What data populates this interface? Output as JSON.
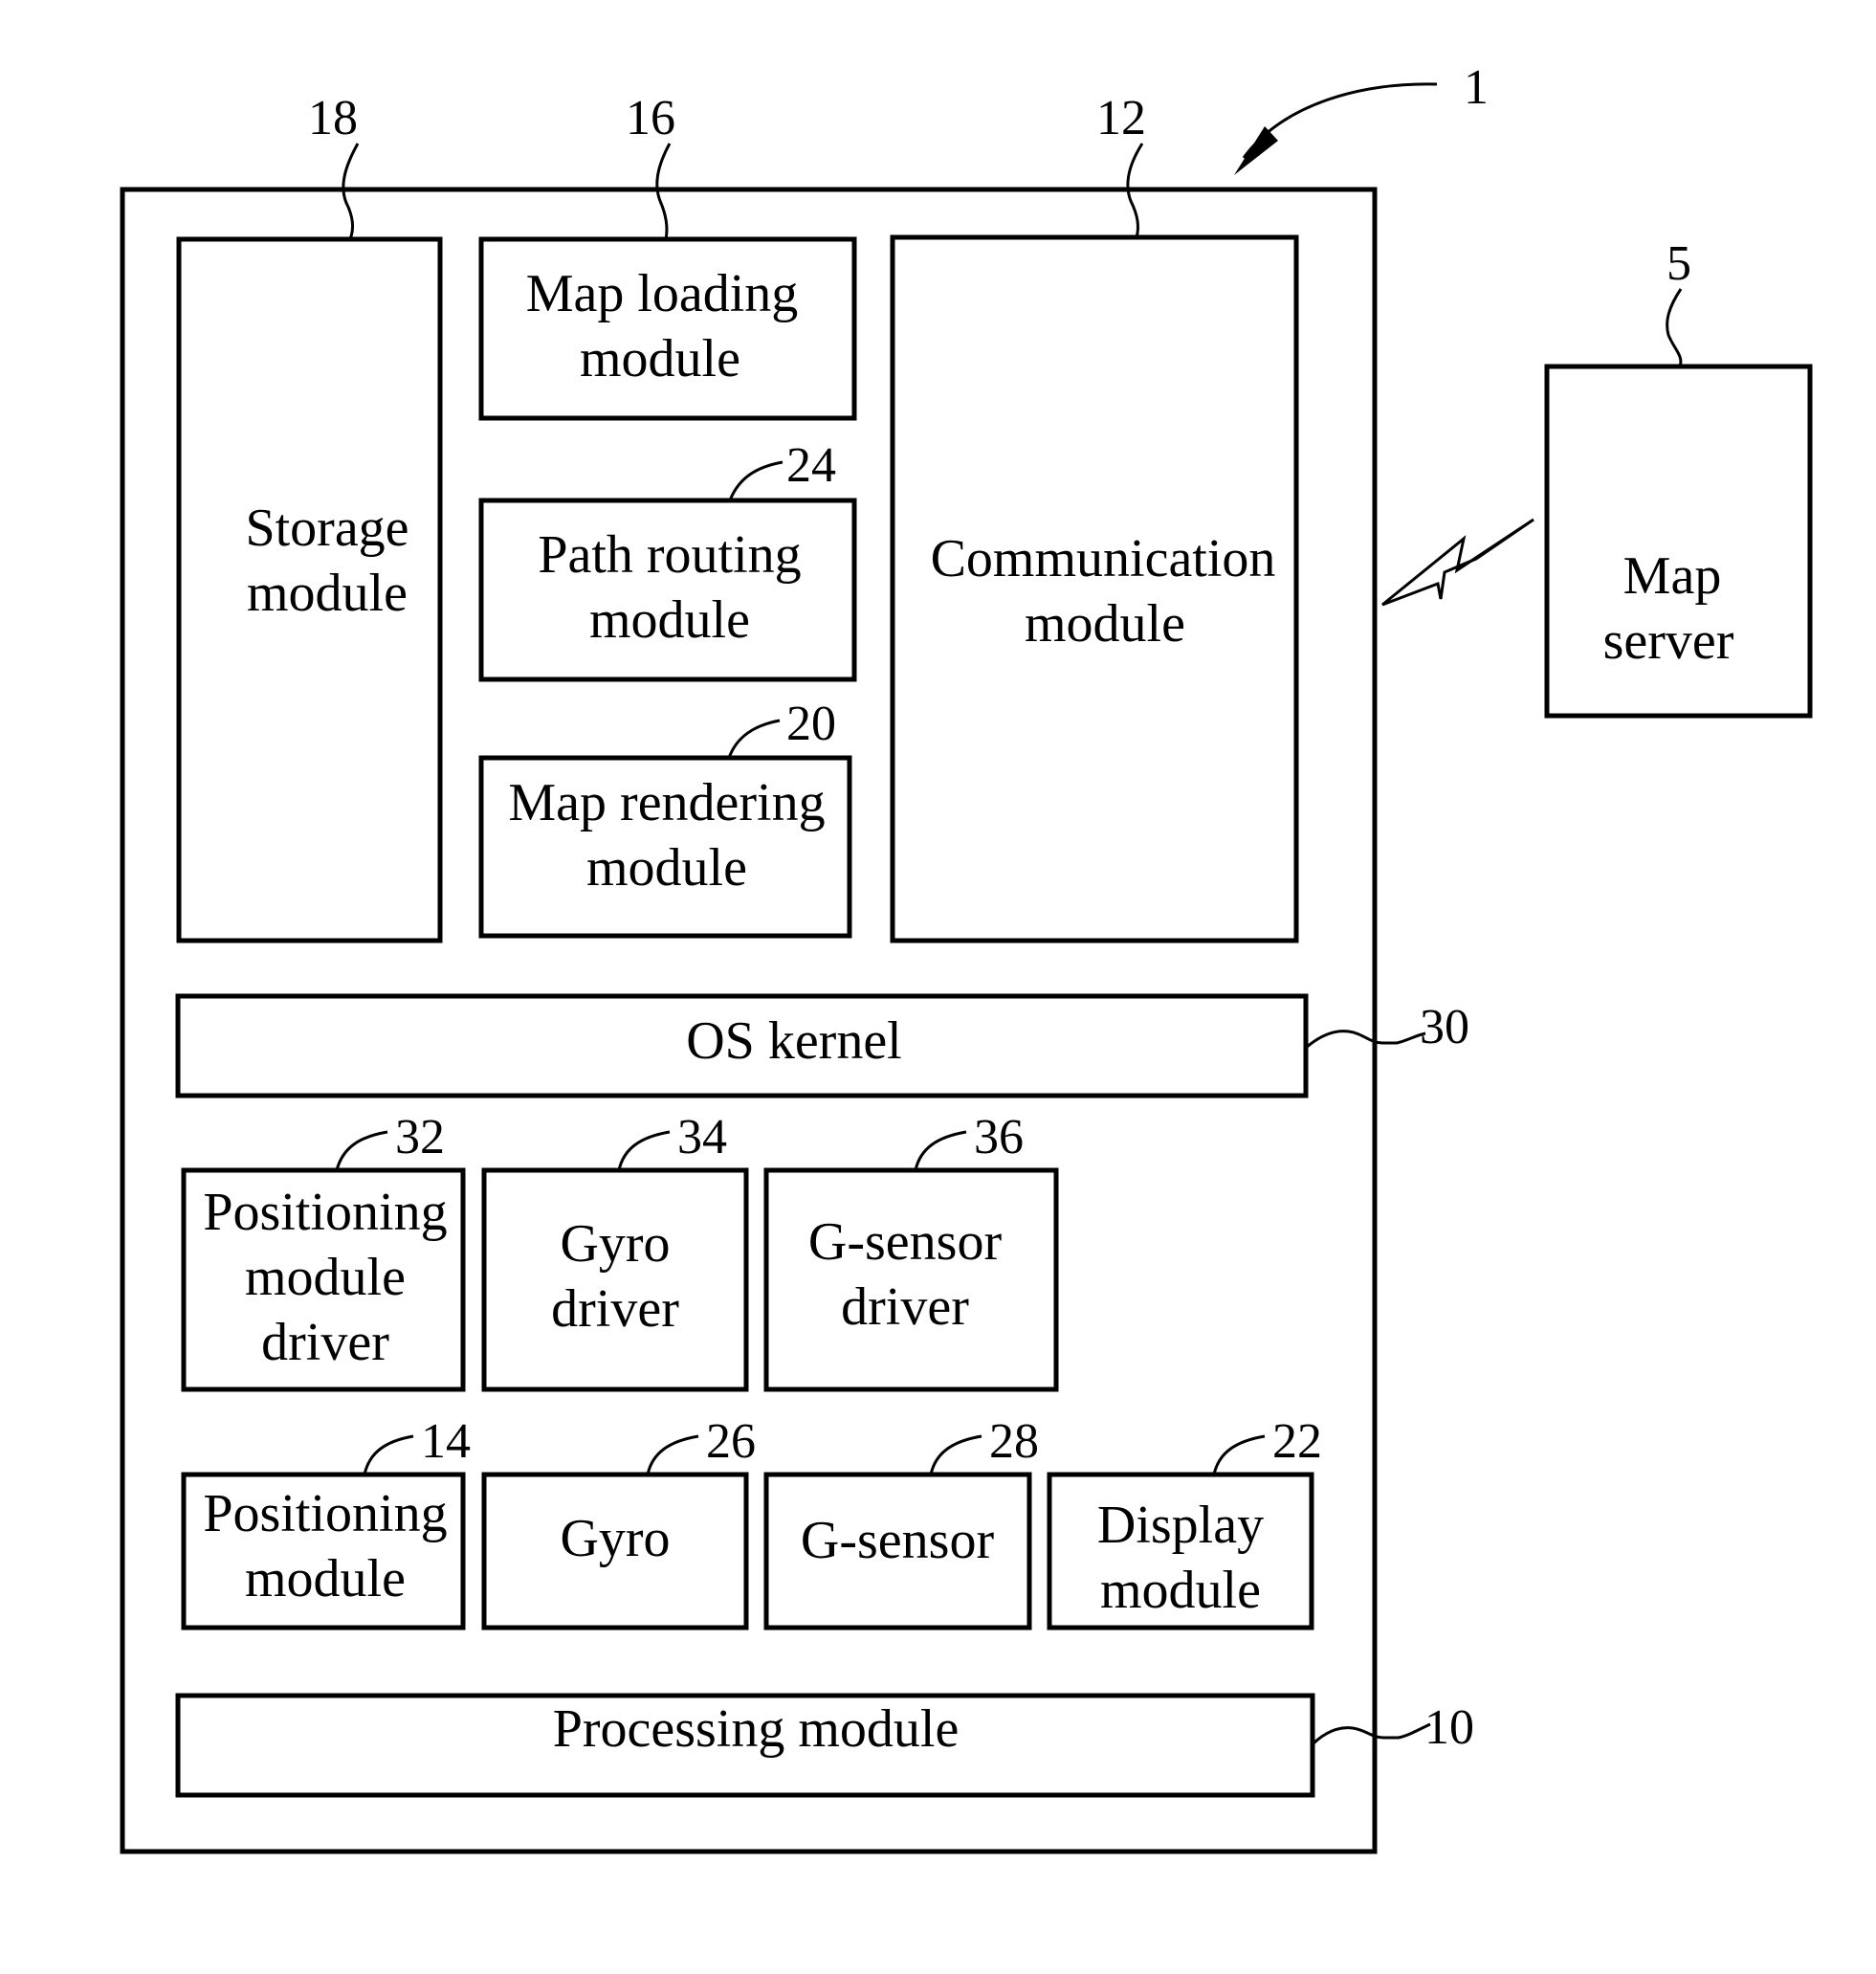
{
  "figure": {
    "device_ref": "1",
    "server": {
      "ref": "5",
      "lines": [
        "Map",
        "server"
      ]
    },
    "modules": {
      "storage": {
        "ref": "18",
        "lines": [
          "Storage",
          "module"
        ]
      },
      "map_loading": {
        "ref": "16",
        "lines": [
          "Map loading",
          "module"
        ]
      },
      "communication": {
        "ref": "12",
        "lines": [
          "Communication",
          "module"
        ]
      },
      "path_routing": {
        "ref": "24",
        "lines": [
          "Path routing",
          "module"
        ]
      },
      "map_rendering": {
        "ref": "20",
        "lines": [
          "Map rendering",
          "module"
        ]
      },
      "os_kernel": {
        "ref": "30",
        "lines": [
          "OS kernel"
        ]
      },
      "positioning_driver": {
        "ref": "32",
        "lines": [
          "Positioning",
          "module",
          "driver"
        ]
      },
      "gyro_driver": {
        "ref": "34",
        "lines": [
          "Gyro",
          "driver"
        ]
      },
      "gsensor_driver": {
        "ref": "36",
        "lines": [
          "G-sensor",
          "driver"
        ]
      },
      "positioning": {
        "ref": "14",
        "lines": [
          "Positioning",
          "module"
        ]
      },
      "gyro": {
        "ref": "26",
        "lines": [
          "Gyro"
        ]
      },
      "gsensor": {
        "ref": "28",
        "lines": [
          "G-sensor"
        ]
      },
      "display": {
        "ref": "22",
        "lines": [
          "Display",
          "module"
        ]
      },
      "processing": {
        "ref": "10",
        "lines": [
          "Processing module"
        ]
      }
    },
    "connections": [
      {
        "from": "device",
        "to": "server",
        "type": "wireless",
        "icon": "lightning-bolt-icon"
      }
    ]
  }
}
